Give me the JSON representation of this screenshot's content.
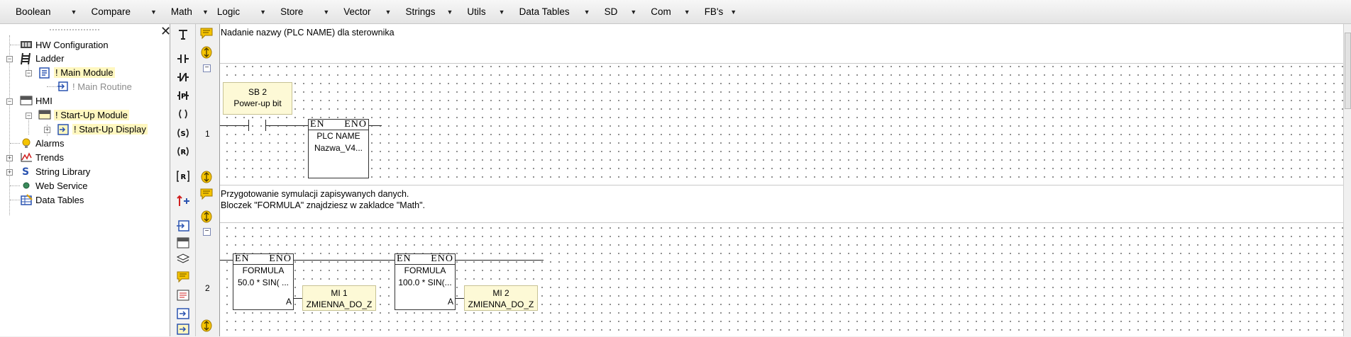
{
  "menubar": {
    "items": [
      {
        "label": "Boolean"
      },
      {
        "label": "Compare"
      },
      {
        "label": "Math"
      },
      {
        "label": "Logic"
      },
      {
        "label": "Store"
      },
      {
        "label": "Vector"
      },
      {
        "label": "Strings"
      },
      {
        "label": "Utils"
      },
      {
        "label": "Data Tables"
      },
      {
        "label": "SD"
      },
      {
        "label": "Com"
      },
      {
        "label": "FB's"
      }
    ],
    "arrow": "▼"
  },
  "tree": {
    "close_glyph": "✕",
    "items": [
      {
        "label": "HW Configuration"
      },
      {
        "label": "Ladder"
      },
      {
        "label": "! Main Module"
      },
      {
        "label": "! Main Routine"
      },
      {
        "label": "HMI"
      },
      {
        "label": "! Start-Up Module"
      },
      {
        "label": "! Start-Up Display"
      },
      {
        "label": "Alarms"
      },
      {
        "label": "Trends"
      },
      {
        "label": "String Library"
      },
      {
        "label": "Web Service"
      },
      {
        "label": "Data Tables"
      }
    ],
    "minus": "−",
    "plus": "+"
  },
  "ladder": {
    "rung1": {
      "number": "1",
      "comment": "Nadanie nazwy (PLC NAME) dla sterownika",
      "contact": {
        "line1": "SB 2",
        "line2": "Power-up bit"
      },
      "fb": {
        "en": "EN",
        "eno": "ENO",
        "name": "PLC NAME",
        "value": "Nazwa_V4..."
      }
    },
    "rung2": {
      "number": "2",
      "comment_line1": "Przygotowanie symulacji zapisywanych danych.",
      "comment_line2": "Bloczek \"FORMULA\" znajdziesz w zakladce \"Math\".",
      "fb1": {
        "en": "EN",
        "eno": "ENO",
        "name": "FORMULA",
        "value": "50.0 * SIN( ...",
        "port": "A"
      },
      "out1": {
        "line1": "MI 1",
        "line2": "ZMIENNA_DO_Z"
      },
      "fb2": {
        "en": "EN",
        "eno": "ENO",
        "name": "FORMULA",
        "value": "100.0 * SIN(...",
        "port": "A"
      },
      "out2": {
        "line1": "MI 2",
        "line2": "ZMIENNA_DO_Z"
      }
    },
    "collapse_glyph": "−"
  },
  "colors": {
    "highlight": "#fff7bf",
    "label_fill": "#fdf9d6",
    "comment_icon": "#f5c400"
  }
}
